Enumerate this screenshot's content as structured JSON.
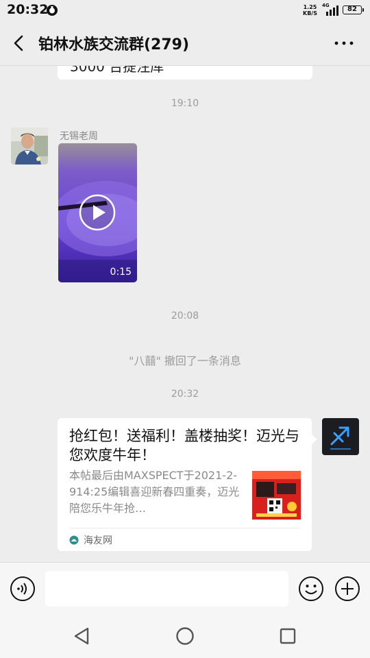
{
  "status_bar": {
    "time": "20:32",
    "net_speed_value": "1.25",
    "net_speed_unit": "KB/S",
    "network_type": "4G",
    "battery": "82"
  },
  "header": {
    "title": "铂林水族交流群(279)",
    "back_icon": "chevron-left-icon",
    "more_icon": "more-dots-icon"
  },
  "messages": {
    "prev_card_fragment": "3000 台提注库",
    "ts_1": "19:10",
    "video_msg": {
      "sender": "无锡老周",
      "duration": "0:15"
    },
    "ts_2": "20:08",
    "recall_notice": "\"八囍\" 撤回了一条消息",
    "ts_3": "20:32",
    "link_card": {
      "title": "抢红包！送福利！盖楼抽奖！迈光与您欢度牛年！",
      "description": "本帖最后由MAXSPECT于2021-2-914:25编辑喜迎新春四重奏，迈光陪您乐牛年抢…",
      "source": "海友网"
    }
  },
  "input_bar": {
    "voice_icon": "voice-icon",
    "emoji_icon": "emoji-icon",
    "plus_icon": "plus-icon"
  },
  "system_nav": {
    "back_icon": "triangle-back-icon",
    "home_icon": "circle-home-icon",
    "recent_icon": "square-recent-icon"
  },
  "colors": {
    "background": "#ededed",
    "card": "#ffffff",
    "timestamp": "#9b9b9b"
  }
}
